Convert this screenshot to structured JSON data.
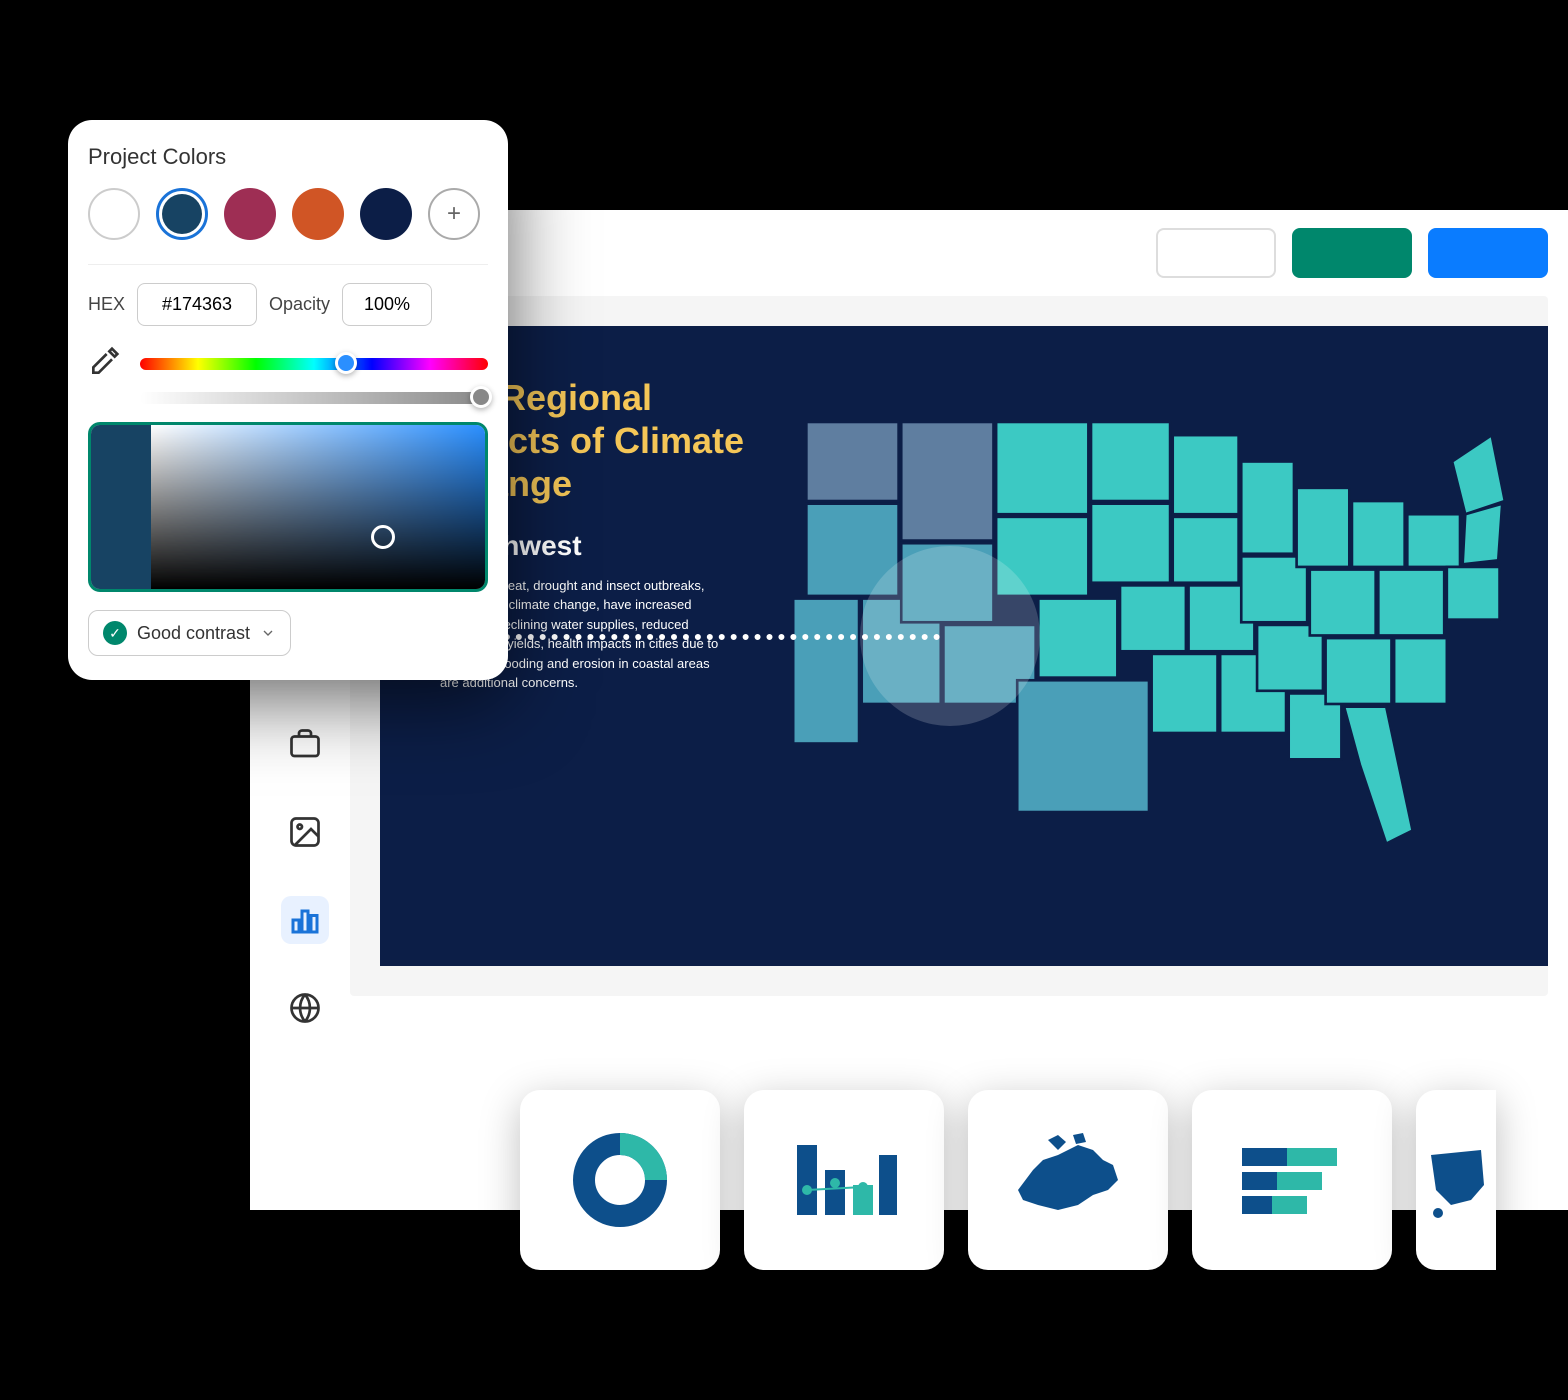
{
  "colorPanel": {
    "title": "Project Colors",
    "swatches": [
      {
        "color": "#ffffff",
        "outline": true
      },
      {
        "color": "#174363",
        "selected": true
      },
      {
        "color": "#9e2e54"
      },
      {
        "color": "#d05525"
      },
      {
        "color": "#0c1e47"
      }
    ],
    "hexLabel": "HEX",
    "hexValue": "#174363",
    "opacityLabel": "Opacity",
    "opacityValue": "100%",
    "contrastLabel": "Good contrast",
    "hueThumbPos": "56%",
    "opacityThumbPos": "98%"
  },
  "slide": {
    "title": "US Regional Effects of Climate Change",
    "subtitle": "Southwest",
    "body": "Increased heat, drought and insect outbreaks, all linked to climate change, have increased wildfires. Declining water supplies, reduced agricultural yields, health impacts in cities due to heat, and flooding and erosion in coastal areas are additional concerns."
  },
  "toolbar": {
    "chips": [
      "#ffffff",
      "#00876c",
      "#0a7cff"
    ]
  },
  "sidebar": {
    "icons": [
      "briefcase",
      "image",
      "chart",
      "globe"
    ],
    "activeIndex": 2
  },
  "chartPicker": {
    "types": [
      "donut",
      "bar",
      "map-canada",
      "horizontal-bar",
      "map-us"
    ]
  },
  "colors": {
    "slideBackground": "#0c1e47",
    "slideTitle": "#f4c657",
    "accent": "#00876c",
    "selectRing": "#1a73d8",
    "mapFill1": "#3cc9c3",
    "mapFill2": "#4a9fb8",
    "mapFill3": "#5f7ea0"
  }
}
